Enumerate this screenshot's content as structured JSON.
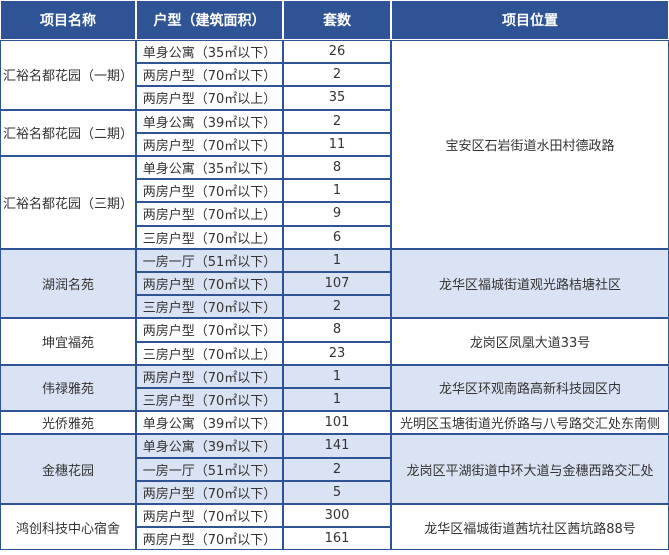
{
  "headers": [
    "项目名称",
    "户型（建筑面积）",
    "套数",
    "项目位置"
  ],
  "rows": [
    {
      "type": "单身公寓（35㎡以下）",
      "count": "26"
    },
    {
      "type": "两房户型（70㎡以下）",
      "count": "2"
    },
    {
      "type": "两房户型（70㎡以上）",
      "count": "35"
    },
    {
      "type": "单身公寓（39㎡以下）",
      "count": "2"
    },
    {
      "type": "两房户型（70㎡以下）",
      "count": "11"
    },
    {
      "type": "单身公寓（35㎡以下）",
      "count": "8"
    },
    {
      "type": "两房户型（70㎡以下）",
      "count": "1"
    },
    {
      "type": "两房户型（70㎡以上）",
      "count": "9"
    },
    {
      "type": "三房户型（70㎡以上）",
      "count": "6"
    },
    {
      "type": "一房一厅（51㎡以下）",
      "count": "1"
    },
    {
      "type": "两房户型（70㎡以下）",
      "count": "107"
    },
    {
      "type": "三房户型（70㎡以下）",
      "count": "2"
    },
    {
      "type": "两房户型（70㎡以下）",
      "count": "8"
    },
    {
      "type": "三房户型（70㎡以上）",
      "count": "23"
    },
    {
      "type": "两房户型（70㎡以下）",
      "count": "1"
    },
    {
      "type": "三房户型（70㎡以下）",
      "count": "1"
    },
    {
      "type": "单身公寓（39㎡以下）",
      "count": "101"
    },
    {
      "type": "单身公寓（39㎡以下）",
      "count": "141"
    },
    {
      "type": "一房一厅（51㎡以下）",
      "count": "2"
    },
    {
      "type": "两房户型（70㎡以下）",
      "count": "5"
    },
    {
      "type": "两房户型（70㎡以下）",
      "count": "300"
    },
    {
      "type": "两房户型（70㎡以下）",
      "count": "161"
    }
  ],
  "projects": [
    "汇裕名都花园（一期）",
    "汇裕名都花园（二期）",
    "汇裕名都花园（三期）",
    "湖润名苑",
    "坤宜福苑",
    "伟禄雅苑",
    "光侨雅苑",
    "金穗花园",
    "鸿创科技中心宿舍"
  ],
  "locations": [
    "宝安区石岩街道水田村德政路",
    "龙华区福城街道观光路桔塘社区",
    "龙岗区凤凰大道33号",
    "龙华区环观南路高新科技园区内",
    "光明区玉塘街道光侨路与八号路交汇处东南侧",
    "龙岗区平湖街道中环大道与金穗西路交汇处",
    "龙华区福城街道茜坑社区茜坑路88号"
  ]
}
